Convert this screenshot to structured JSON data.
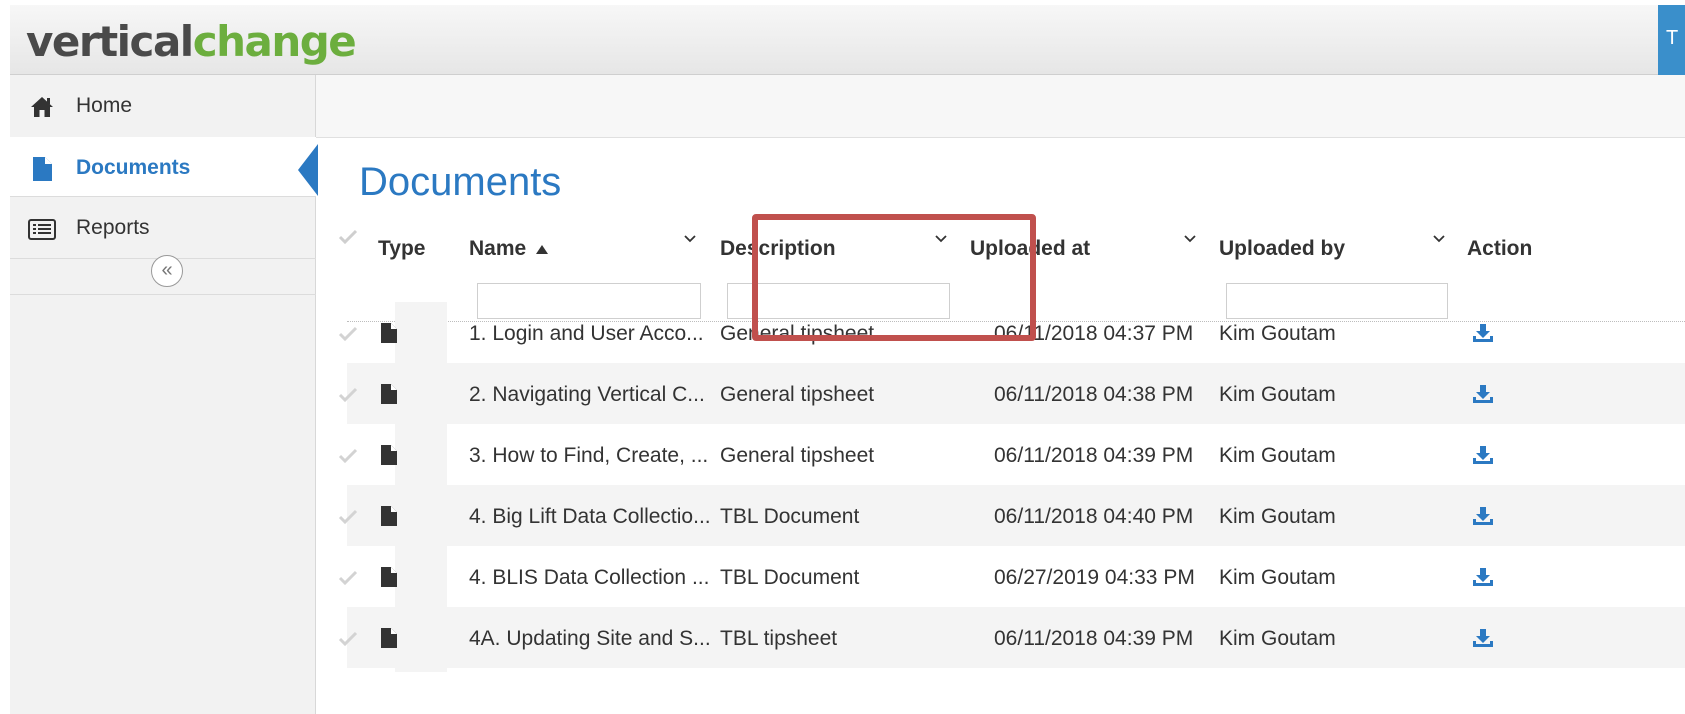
{
  "app": {
    "logo_part1": "vertical",
    "logo_part2": "change",
    "top_button_label": "T"
  },
  "sidebar": {
    "items": [
      {
        "label": "Home",
        "icon": "home-icon"
      },
      {
        "label": "Documents",
        "icon": "document-icon",
        "active": true
      },
      {
        "label": "Reports",
        "icon": "reports-icon"
      }
    ],
    "collapse_glyph": "«"
  },
  "page": {
    "title": "Documents"
  },
  "table": {
    "columns": [
      "Type",
      "Name",
      "Description",
      "Uploaded at",
      "Uploaded by",
      "Action"
    ],
    "rows": [
      {
        "name": "1. Login and User Acco...",
        "description": "General tipsheet",
        "uploaded_at": "06/11/2018 04:37 PM",
        "uploaded_by": "Kim Goutam"
      },
      {
        "name": "2. Navigating Vertical C...",
        "description": "General tipsheet",
        "uploaded_at": "06/11/2018 04:38 PM",
        "uploaded_by": "Kim Goutam"
      },
      {
        "name": "3. How to Find, Create, ...",
        "description": "General tipsheet",
        "uploaded_at": "06/11/2018 04:39 PM",
        "uploaded_by": "Kim Goutam"
      },
      {
        "name": "4. Big Lift Data Collectio...",
        "description": "TBL Document",
        "uploaded_at": "06/11/2018 04:40 PM",
        "uploaded_by": "Kim Goutam"
      },
      {
        "name": "4. BLIS Data Collection ...",
        "description": "TBL Document",
        "uploaded_at": "06/27/2019 04:33 PM",
        "uploaded_by": "Kim Goutam"
      },
      {
        "name": "4A. Updating Site and S...",
        "description": "TBL tipsheet",
        "uploaded_at": "06/11/2018 04:39 PM",
        "uploaded_by": "Kim Goutam"
      }
    ]
  },
  "colors": {
    "accent": "#2b79c2",
    "logo_green": "#6cae3e",
    "highlight": "#c0504d"
  }
}
